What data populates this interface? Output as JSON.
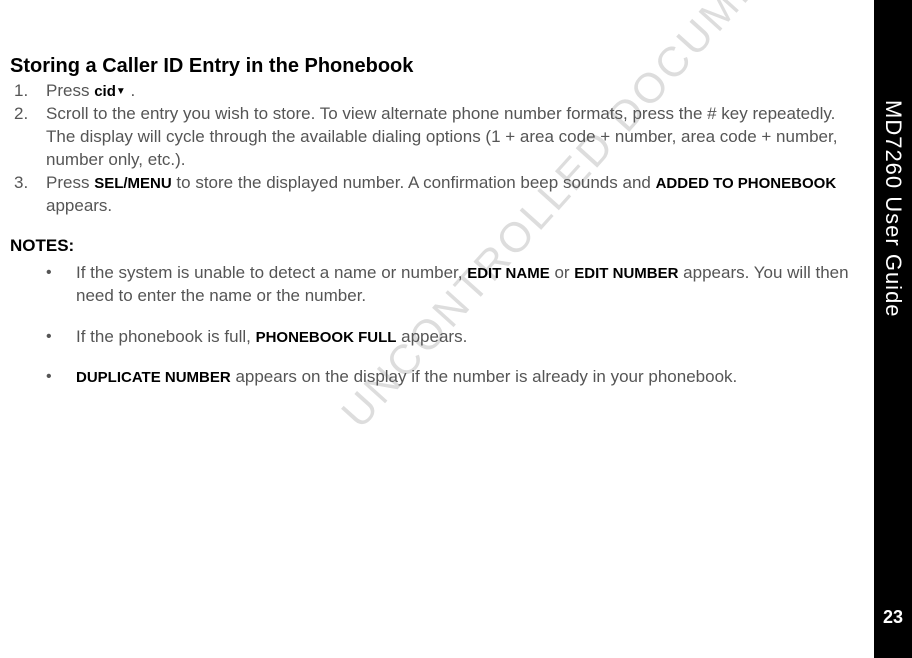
{
  "sidebar": {
    "title": "MD7260 User Guide",
    "page_number": "23"
  },
  "watermark": "UNCONTROLLED DOCUMENT",
  "section": {
    "heading": "Storing a Caller ID Entry in the Phonebook",
    "steps": [
      {
        "number": "1.",
        "prefix": "Press ",
        "bold1": "cid",
        "icon": "▼",
        "suffix": " ."
      },
      {
        "number": "2.",
        "text": "Scroll to the entry you wish to store. To view alternate phone number formats, press the # key repeatedly. The display will cycle through the available dialing options (1 + area code + number, area code + number, number only, etc.)."
      },
      {
        "number": "3.",
        "prefix": "Press ",
        "bold1": "SEL/MENU",
        "middle": " to store the displayed number. A confirmation beep sounds and ",
        "bold2": "ADDED TO PHONEBOOK",
        "suffix": " appears."
      }
    ],
    "notes_heading": "NOTES:",
    "notes": [
      {
        "prefix": "If the system is unable to detect a name or number, ",
        "bold1": "EDIT NAME",
        "middle": " or ",
        "bold2": "EDIT NUMBER",
        "suffix": " appears. You will then need to enter the name or the number."
      },
      {
        "prefix": "If the phonebook is full, ",
        "bold1": "PHONEBOOK FULL",
        "suffix": " appears."
      },
      {
        "bold1": "DUPLICATE NUMBER",
        "suffix": "  appears on the display if the number is already in your phonebook."
      }
    ]
  }
}
